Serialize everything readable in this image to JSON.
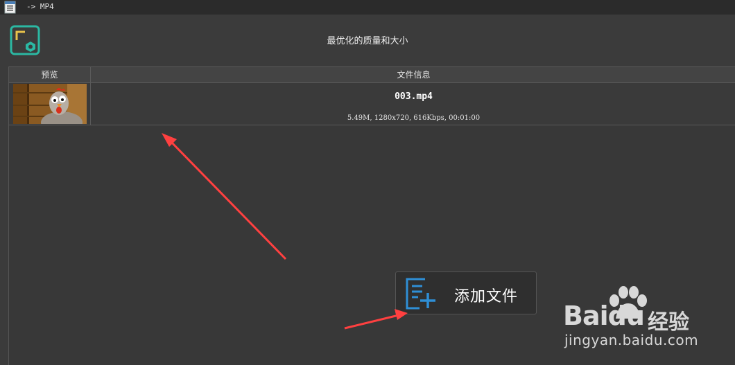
{
  "window": {
    "title": "-> MP4"
  },
  "header": {
    "quality_label": "最优化的质量和大小"
  },
  "table": {
    "columns": [
      "预览",
      "文件信息"
    ],
    "rows": [
      {
        "filename": "003.mp4",
        "details": "5.49M, 1280x720, 616Kbps, 00:01:00"
      }
    ]
  },
  "add_button": {
    "label": "添加文件"
  },
  "watermark": {
    "logo": "Baidu",
    "logo_cn": "经验",
    "url": "jingyan.baidu.com"
  },
  "colors": {
    "accent_teal": "#2bb8a3",
    "accent_yellow": "#e8c24a",
    "accent_blue": "#2f8fd6",
    "arrow_red": "#ff4040",
    "background": "#3b3b3b"
  }
}
